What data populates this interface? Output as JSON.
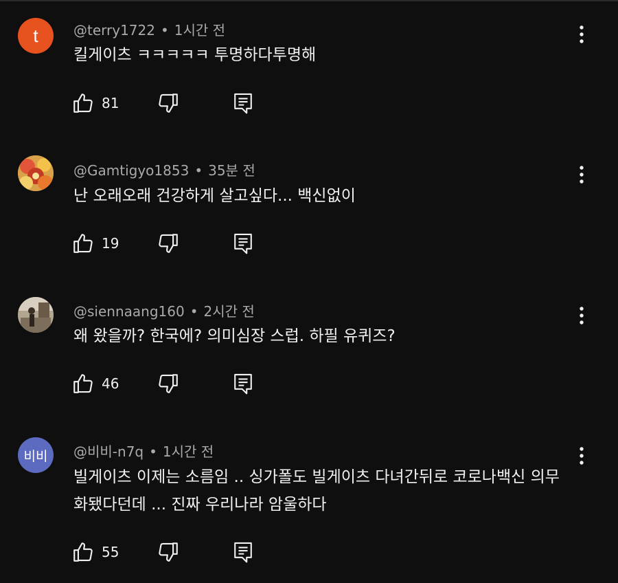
{
  "comments": [
    {
      "avatar_text": "t",
      "avatar_color": "#e8521f",
      "author": "@terry1722",
      "separator": "•",
      "time": "1시간 전",
      "text": "킬게이츠 ㅋㅋㅋㅋㅋ 투명하다투명해",
      "likes": "81"
    },
    {
      "avatar_text": "",
      "avatar_color": "#c98a2c",
      "author": "@Gamtigyo1853",
      "separator": "•",
      "time": "35분 전",
      "text": "난 오래오래 건강하게 살고싶다...  백신없이",
      "likes": "19"
    },
    {
      "avatar_text": "",
      "avatar_color": "#8a7a66",
      "author": "@siennaang160",
      "separator": "•",
      "time": "2시간 전",
      "text": "왜 왔을까? 한국에? 의미심장 스럽. 하필 유퀴즈?",
      "likes": "46"
    },
    {
      "avatar_text": "비비",
      "avatar_color": "#5c6bc0",
      "author": "@비비-n7q",
      "separator": "•",
      "time": "1시간 전",
      "text": "빌게이츠 이제는 소름임 .. 싱가폴도 빌게이츠 다녀간뒤로 코로나백신 의무화됐다던데 ... 진짜 우리나라 암울하다",
      "likes": "55"
    }
  ],
  "icons": {
    "like": "thumb-up-icon",
    "dislike": "thumb-down-icon",
    "reply": "comment-reply-icon",
    "more": "more-vertical-icon"
  }
}
